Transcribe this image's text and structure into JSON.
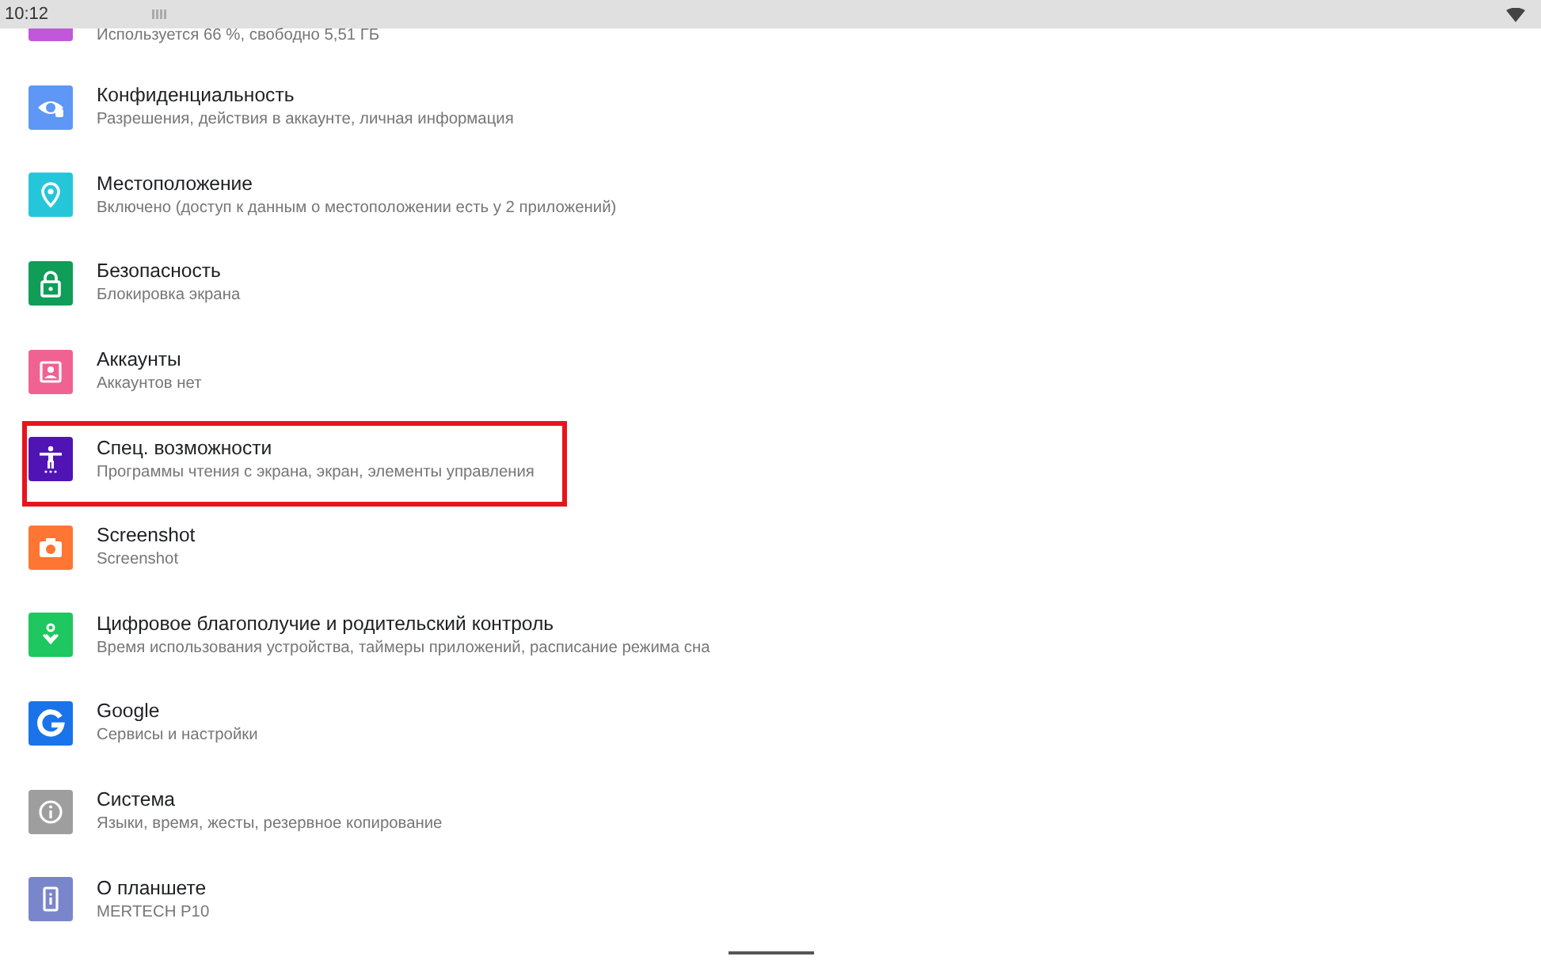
{
  "status_bar": {
    "time": "10:12"
  },
  "partial_item": {
    "subtitle": "Используется 66 %, свободно 5,51 ГБ",
    "color": "#c158dc"
  },
  "items": [
    {
      "kind": "privacy",
      "color": "#5e97f6",
      "title": "Конфиденциальность",
      "subtitle": "Разрешения, действия в аккаунте, личная информация",
      "highlighted": false
    },
    {
      "kind": "location",
      "color": "#26c6da",
      "title": "Местоположение",
      "subtitle": "Включено (доступ к данным о местоположении есть у 2 приложений)",
      "highlighted": false
    },
    {
      "kind": "lock",
      "color": "#0f9d58",
      "title": "Безопасность",
      "subtitle": "Блокировка экрана",
      "highlighted": false
    },
    {
      "kind": "account",
      "color": "#f06292",
      "title": "Аккаунты",
      "subtitle": "Аккаунтов нет",
      "highlighted": false
    },
    {
      "kind": "accessibility",
      "color": "#5014b4",
      "title": "Спец. возможности",
      "subtitle": "Программы чтения с экрана, экран, элементы управления",
      "highlighted": true
    },
    {
      "kind": "camera",
      "color": "#ff7533",
      "title": "Screenshot",
      "subtitle": "Screenshot",
      "highlighted": false
    },
    {
      "kind": "wellbeing",
      "color": "#1ec760",
      "title": "Цифровое благополучие и родительский контроль",
      "subtitle": "Время использования устройства, таймеры приложений, расписание режима сна",
      "highlighted": false
    },
    {
      "kind": "google",
      "color": "#1a73e8",
      "title": "Google",
      "subtitle": "Сервисы и настройки",
      "highlighted": false
    },
    {
      "kind": "info",
      "color": "#9e9e9e",
      "title": "Система",
      "subtitle": "Языки, время, жесты, резервное копирование",
      "highlighted": false
    },
    {
      "kind": "tablet",
      "color": "#7986cb",
      "title": "О планшете",
      "subtitle": "MERTECH P10",
      "highlighted": false
    }
  ]
}
